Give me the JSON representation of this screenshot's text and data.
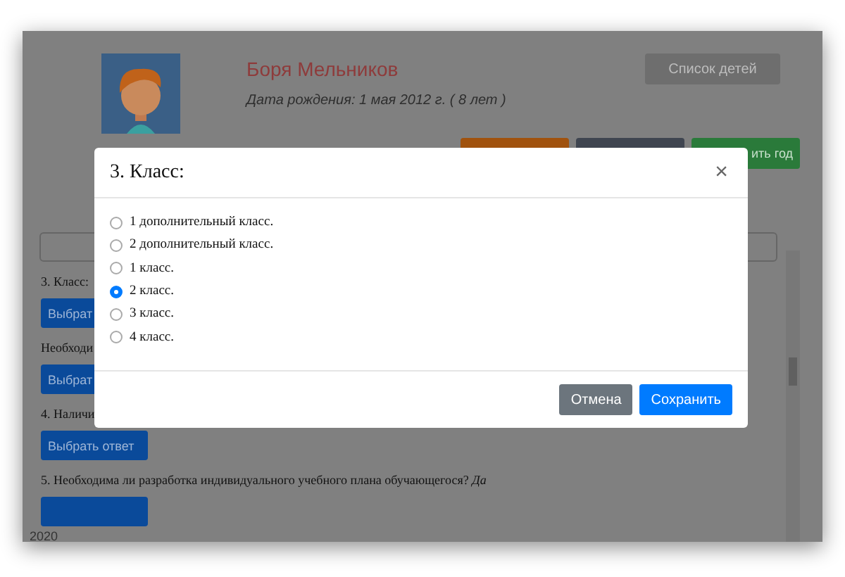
{
  "profile": {
    "name": "Боря Мельников",
    "birth_date": "Дата рождения: 1 мая 2012 г. ( 8 лет )",
    "children_button": "Список детей"
  },
  "action_buttons": [
    {
      "color": "#a0520e"
    },
    {
      "color": "#3f4550"
    },
    {
      "color": "#2a7a3a",
      "label": "ить год"
    }
  ],
  "questions": [
    {
      "kind": "text",
      "text": "3. Класс:"
    },
    {
      "kind": "button",
      "label": "Выбрат"
    },
    {
      "kind": "text",
      "text": "Необходи"
    },
    {
      "kind": "button",
      "label": "Выбрат"
    },
    {
      "kind": "text",
      "text": "4. Наличи"
    },
    {
      "kind": "button",
      "label": "Выбрать ответ"
    },
    {
      "kind": "text",
      "text": "5. Необходима ли разработка индивидуального учебного плана обучающегося? *Да*"
    },
    {
      "kind": "button"
    }
  ],
  "footer": "2020",
  "modal": {
    "title": "3. Класс:",
    "close": "×",
    "options": [
      {
        "label": "1 дополнительный класс.",
        "selected": false
      },
      {
        "label": "2 дополнительный класс.",
        "selected": false
      },
      {
        "label": "1 класс.",
        "selected": false
      },
      {
        "label": "2 класс.",
        "selected": true
      },
      {
        "label": "3 класс.",
        "selected": false
      },
      {
        "label": "4 класс.",
        "selected": false
      }
    ],
    "cancel": "Отмена",
    "save": "Сохранить"
  }
}
